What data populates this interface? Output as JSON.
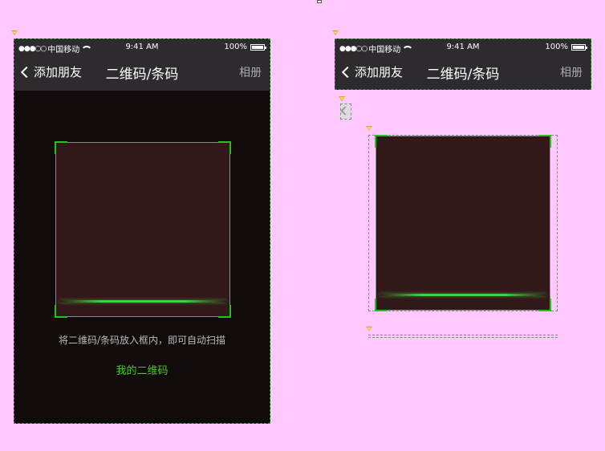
{
  "status_bar": {
    "dots": "●●●○○",
    "carrier": "中国移动",
    "time": "9:41 AM",
    "battery": "100%"
  },
  "navbar": {
    "back_label": "添加朋友",
    "title": "二维码/条码",
    "right_label": "相册"
  },
  "scanner": {
    "hint": "将二维码/条码放入框内，即可自动扫描",
    "my_qr_label": "我的二维码"
  },
  "colors": {
    "background": "#ffc8ff",
    "nav_bg": "#2d2b30",
    "accent_green": "#21c321"
  }
}
